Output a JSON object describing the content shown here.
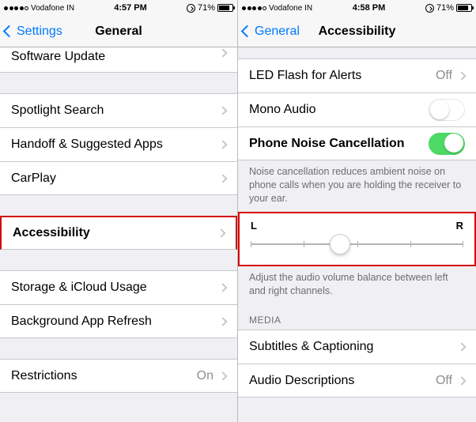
{
  "left": {
    "status": {
      "carrier": "Vodafone IN",
      "time": "4:57 PM",
      "battery": "71%"
    },
    "nav": {
      "back": "Settings",
      "title": "General"
    },
    "rows": {
      "software_update": "Software Update",
      "spotlight": "Spotlight Search",
      "handoff": "Handoff & Suggested Apps",
      "carplay": "CarPlay",
      "accessibility": "Accessibility",
      "storage": "Storage & iCloud Usage",
      "bgrefresh": "Background App Refresh",
      "restrictions": "Restrictions",
      "restrictions_value": "On"
    }
  },
  "right": {
    "status": {
      "carrier": "Vodafone IN",
      "time": "4:58 PM",
      "battery": "71%"
    },
    "nav": {
      "back": "General",
      "title": "Accessibility"
    },
    "rows": {
      "led": "LED Flash for Alerts",
      "led_value": "Off",
      "mono": "Mono Audio",
      "noise": "Phone Noise Cancellation",
      "subtitles": "Subtitles & Captioning",
      "audiodesc": "Audio Descriptions",
      "audiodesc_value": "Off"
    },
    "footer_noise": "Noise cancellation reduces ambient noise on phone calls when you are holding the receiver to your ear.",
    "slider": {
      "left": "L",
      "right": "R"
    },
    "footer_slider": "Adjust the audio volume balance between left and right channels.",
    "media_header": "MEDIA"
  }
}
